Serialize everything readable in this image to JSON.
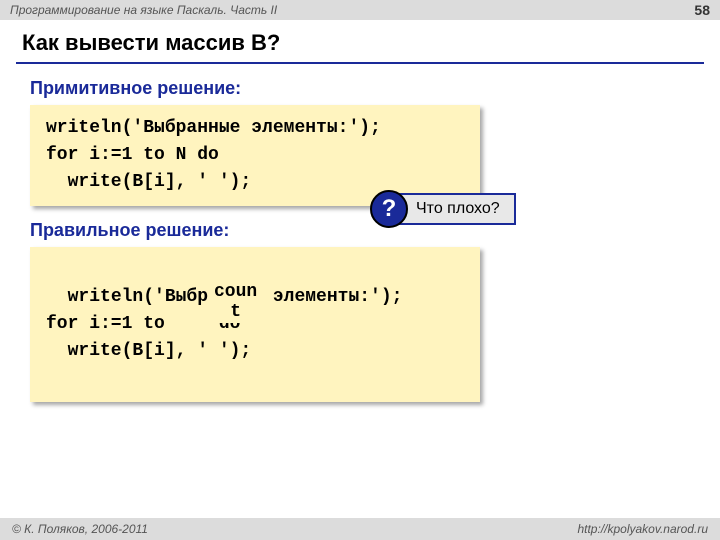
{
  "header": {
    "course": "Программирование на языке Паскаль. Часть II",
    "page": "58"
  },
  "title": "Как вывести массив B?",
  "section1": {
    "label": "Примитивное решение:",
    "code": "writeln('Выбранные элементы:');\nfor i:=1 to N do\n  write(B[i], ' ');"
  },
  "callout": {
    "mark": "?",
    "text": "Что плохо?"
  },
  "section2": {
    "label": "Правильное решение:",
    "code": "writeln('Выбранные элементы:');\nfor i:=1 to     do\n  write(B[i], ' ');",
    "patch": "coun\nt"
  },
  "footer": {
    "copyright": "© К. Поляков, 2006-2011",
    "url": "http://kpolyakov.narod.ru"
  }
}
